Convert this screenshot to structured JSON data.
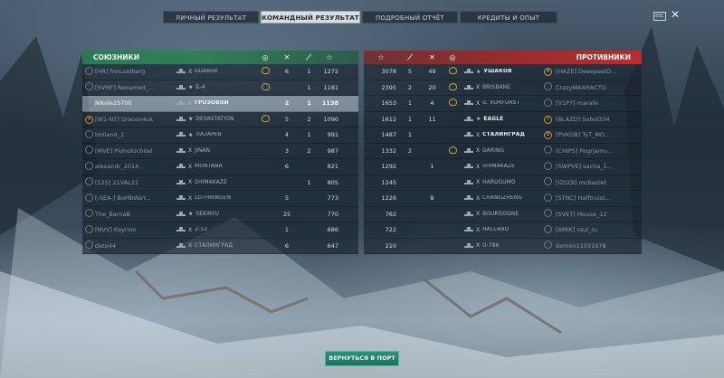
{
  "tabs": [
    {
      "label": "ЛИЧНЫЙ РЕЗУЛЬТАТ",
      "active": false
    },
    {
      "label": "КОМАНДНЫЙ РЕЗУЛЬТАТ",
      "active": true
    },
    {
      "label": "ПОДРОБНЫЙ ОТЧЁТ",
      "active": false
    },
    {
      "label": "КРЕДИТЫ И ОПЫТ",
      "active": false
    }
  ],
  "esc_label": "ESC",
  "close_symbol": "✕",
  "allies": {
    "title": "СОЮЗНИКИ",
    "header_icons": [
      "medal-icon",
      "kills-icon",
      "assist-icon",
      "star-icon"
    ],
    "players": [
      {
        "badge": "",
        "player": "[HR] fonLustberg",
        "tier": "X",
        "ship": "GDAŃSK",
        "medal": true,
        "kills": "6",
        "assist": "1",
        "xp": "1272",
        "self": false,
        "alive": false
      },
      {
        "badge": "",
        "player": "[SVMF] Renamed_...",
        "tier": "★",
        "ship": "Б-4",
        "medal": true,
        "kills": "",
        "assist": "1",
        "xp": "1181",
        "self": false,
        "alive": false
      },
      {
        "badge": "",
        "player": "Nikola25700",
        "tier": "X",
        "ship": "ГРОЗОВОЙ",
        "medal": false,
        "kills": "2",
        "assist": "1",
        "xp": "1138",
        "self": true,
        "alive": true
      },
      {
        "badge": "4",
        "player": "[W1-NT] Dracon4uk",
        "tier": "★",
        "ship": "DEVASTATION",
        "medal": true,
        "kills": "5",
        "assist": "2",
        "xp": "1090",
        "self": false,
        "alive": false
      },
      {
        "badge": "",
        "player": "Holland_1",
        "tier": "★",
        "ship": "ЛАЗАРЕВ",
        "medal": false,
        "kills": "4",
        "assist": "1",
        "xp": "991",
        "self": false,
        "alive": false
      },
      {
        "badge": "",
        "player": "[MVE] PlohoiUchitel",
        "tier": "X",
        "ship": "JINAN",
        "medal": false,
        "kills": "3",
        "assist": "2",
        "xp": "987",
        "self": false,
        "alive": false
      },
      {
        "badge": "",
        "player": "alexandr_2014",
        "tier": "X",
        "ship": "MONTANA",
        "medal": false,
        "kills": "6",
        "assist": "",
        "xp": "821",
        "self": false,
        "alive": false
      },
      {
        "badge": "",
        "player": "[125] 21VAL21",
        "tier": "X",
        "ship": "SHIMAKAZE",
        "medal": false,
        "kills": "",
        "assist": "1",
        "xp": "805",
        "self": false,
        "alive": false
      },
      {
        "badge": "",
        "player": "[-SEA-] BoMbWaY...",
        "tier": "X",
        "ship": "LOTHRINGEN",
        "medal": false,
        "kills": "5",
        "assist": "",
        "xp": "773",
        "self": false,
        "alive": false
      },
      {
        "badge": "",
        "player": "The_BarnaB",
        "tier": "★",
        "ship": "SEKIRYU",
        "medal": false,
        "kills": "25",
        "assist": "",
        "xp": "770",
        "self": false,
        "alive": false
      },
      {
        "badge": "",
        "player": "[NVV] Kayrion",
        "tier": "X",
        "ship": "Z-52",
        "medal": false,
        "kills": "1",
        "assist": "",
        "xp": "686",
        "self": false,
        "alive": false
      },
      {
        "badge": "",
        "player": "dato44",
        "tier": "X",
        "ship": "СТАЛИНГРАД",
        "medal": false,
        "kills": "6",
        "assist": "",
        "xp": "647",
        "self": false,
        "alive": false
      }
    ]
  },
  "enemies": {
    "title": "ПРОТИВНИКИ",
    "header_icons": [
      "star-icon",
      "assist-icon",
      "kills-icon",
      "medal-icon"
    ],
    "players": [
      {
        "xp": "3078",
        "assist": "5",
        "kills": "49",
        "medal": true,
        "tier": "★",
        "ship": "УШАКОВ",
        "badge": "4",
        "player": "[HAZE] DeeepestD...",
        "alive": true
      },
      {
        "xp": "2395",
        "assist": "2",
        "kills": "20",
        "medal": true,
        "tier": "X",
        "ship": "BRISBANE",
        "badge": "",
        "player": "CrazyМАХНАСТО",
        "alive": false
      },
      {
        "xp": "1653",
        "assist": "1",
        "kills": "4",
        "medal": true,
        "tier": "X",
        "ship": "G. KURFÜRST",
        "badge": "",
        "player": "[V1P7] marafe",
        "alive": false
      },
      {
        "xp": "1612",
        "assist": "1",
        "kills": "11",
        "medal": false,
        "tier": "★",
        "ship": "EAGLE",
        "badge": "?",
        "player": "[BLAZD] Sobol334",
        "alive": true
      },
      {
        "xp": "1487",
        "assist": "1",
        "kills": "",
        "medal": false,
        "tier": "X",
        "ship": "СТАЛИНГРАД",
        "badge": "B",
        "player": "[PVKGB] TyT_MO...",
        "alive": true
      },
      {
        "xp": "1332",
        "assist": "2",
        "kills": "",
        "medal": true,
        "tier": "X",
        "ship": "DARING",
        "badge": "",
        "player": "[CHIPS] Pogrjamu...",
        "alive": false
      },
      {
        "xp": "1292",
        "assist": "",
        "kills": "1",
        "medal": false,
        "tier": "X",
        "ship": "SHIMAKAZE",
        "badge": "",
        "player": "[SWPVE] sacha_1...",
        "alive": false
      },
      {
        "xp": "1245",
        "assist": "",
        "kills": "",
        "medal": false,
        "tier": "X",
        "ship": "HARUGUMO",
        "badge": "",
        "player": "[IZGOI] mcbastet",
        "alive": false
      },
      {
        "xp": "1226",
        "assist": "",
        "kills": "8",
        "medal": false,
        "tier": "X",
        "ship": "CHANGZHENG",
        "badge": "",
        "player": "[STNC] Halftruist...",
        "alive": false
      },
      {
        "xp": "762",
        "assist": "",
        "kills": "",
        "medal": false,
        "tier": "X",
        "ship": "BOURGOGNE",
        "badge": "",
        "player": "[SVET] Mouse_12",
        "alive": false
      },
      {
        "xp": "722",
        "assist": "",
        "kills": "",
        "medal": false,
        "tier": "X",
        "ship": "HALLAND",
        "badge": "",
        "player": "[AMIK] raul_ru",
        "alive": false
      },
      {
        "xp": "210",
        "assist": "",
        "kills": "",
        "medal": false,
        "tier": "X",
        "ship": "U-796",
        "badge": "",
        "player": "Semen11031978",
        "alive": false
      }
    ]
  },
  "footer": {
    "back_button": "ВЕРНУТЬСЯ В ПОРТ"
  }
}
